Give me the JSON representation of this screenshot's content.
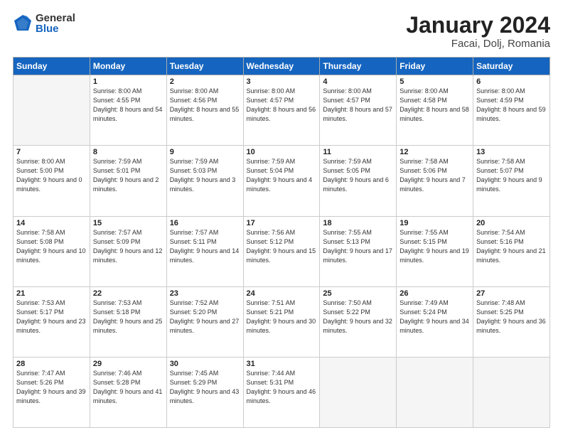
{
  "logo": {
    "general": "General",
    "blue": "Blue"
  },
  "header": {
    "title": "January 2024",
    "subtitle": "Facai, Dolj, Romania"
  },
  "weekdays": [
    "Sunday",
    "Monday",
    "Tuesday",
    "Wednesday",
    "Thursday",
    "Friday",
    "Saturday"
  ],
  "weeks": [
    [
      {
        "day": "",
        "sunrise": "",
        "sunset": "",
        "daylight": ""
      },
      {
        "day": "1",
        "sunrise": "Sunrise: 8:00 AM",
        "sunset": "Sunset: 4:55 PM",
        "daylight": "Daylight: 8 hours and 54 minutes."
      },
      {
        "day": "2",
        "sunrise": "Sunrise: 8:00 AM",
        "sunset": "Sunset: 4:56 PM",
        "daylight": "Daylight: 8 hours and 55 minutes."
      },
      {
        "day": "3",
        "sunrise": "Sunrise: 8:00 AM",
        "sunset": "Sunset: 4:57 PM",
        "daylight": "Daylight: 8 hours and 56 minutes."
      },
      {
        "day": "4",
        "sunrise": "Sunrise: 8:00 AM",
        "sunset": "Sunset: 4:57 PM",
        "daylight": "Daylight: 8 hours and 57 minutes."
      },
      {
        "day": "5",
        "sunrise": "Sunrise: 8:00 AM",
        "sunset": "Sunset: 4:58 PM",
        "daylight": "Daylight: 8 hours and 58 minutes."
      },
      {
        "day": "6",
        "sunrise": "Sunrise: 8:00 AM",
        "sunset": "Sunset: 4:59 PM",
        "daylight": "Daylight: 8 hours and 59 minutes."
      }
    ],
    [
      {
        "day": "7",
        "sunrise": "Sunrise: 8:00 AM",
        "sunset": "Sunset: 5:00 PM",
        "daylight": "Daylight: 9 hours and 0 minutes."
      },
      {
        "day": "8",
        "sunrise": "Sunrise: 7:59 AM",
        "sunset": "Sunset: 5:01 PM",
        "daylight": "Daylight: 9 hours and 2 minutes."
      },
      {
        "day": "9",
        "sunrise": "Sunrise: 7:59 AM",
        "sunset": "Sunset: 5:03 PM",
        "daylight": "Daylight: 9 hours and 3 minutes."
      },
      {
        "day": "10",
        "sunrise": "Sunrise: 7:59 AM",
        "sunset": "Sunset: 5:04 PM",
        "daylight": "Daylight: 9 hours and 4 minutes."
      },
      {
        "day": "11",
        "sunrise": "Sunrise: 7:59 AM",
        "sunset": "Sunset: 5:05 PM",
        "daylight": "Daylight: 9 hours and 6 minutes."
      },
      {
        "day": "12",
        "sunrise": "Sunrise: 7:58 AM",
        "sunset": "Sunset: 5:06 PM",
        "daylight": "Daylight: 9 hours and 7 minutes."
      },
      {
        "day": "13",
        "sunrise": "Sunrise: 7:58 AM",
        "sunset": "Sunset: 5:07 PM",
        "daylight": "Daylight: 9 hours and 9 minutes."
      }
    ],
    [
      {
        "day": "14",
        "sunrise": "Sunrise: 7:58 AM",
        "sunset": "Sunset: 5:08 PM",
        "daylight": "Daylight: 9 hours and 10 minutes."
      },
      {
        "day": "15",
        "sunrise": "Sunrise: 7:57 AM",
        "sunset": "Sunset: 5:09 PM",
        "daylight": "Daylight: 9 hours and 12 minutes."
      },
      {
        "day": "16",
        "sunrise": "Sunrise: 7:57 AM",
        "sunset": "Sunset: 5:11 PM",
        "daylight": "Daylight: 9 hours and 14 minutes."
      },
      {
        "day": "17",
        "sunrise": "Sunrise: 7:56 AM",
        "sunset": "Sunset: 5:12 PM",
        "daylight": "Daylight: 9 hours and 15 minutes."
      },
      {
        "day": "18",
        "sunrise": "Sunrise: 7:55 AM",
        "sunset": "Sunset: 5:13 PM",
        "daylight": "Daylight: 9 hours and 17 minutes."
      },
      {
        "day": "19",
        "sunrise": "Sunrise: 7:55 AM",
        "sunset": "Sunset: 5:15 PM",
        "daylight": "Daylight: 9 hours and 19 minutes."
      },
      {
        "day": "20",
        "sunrise": "Sunrise: 7:54 AM",
        "sunset": "Sunset: 5:16 PM",
        "daylight": "Daylight: 9 hours and 21 minutes."
      }
    ],
    [
      {
        "day": "21",
        "sunrise": "Sunrise: 7:53 AM",
        "sunset": "Sunset: 5:17 PM",
        "daylight": "Daylight: 9 hours and 23 minutes."
      },
      {
        "day": "22",
        "sunrise": "Sunrise: 7:53 AM",
        "sunset": "Sunset: 5:18 PM",
        "daylight": "Daylight: 9 hours and 25 minutes."
      },
      {
        "day": "23",
        "sunrise": "Sunrise: 7:52 AM",
        "sunset": "Sunset: 5:20 PM",
        "daylight": "Daylight: 9 hours and 27 minutes."
      },
      {
        "day": "24",
        "sunrise": "Sunrise: 7:51 AM",
        "sunset": "Sunset: 5:21 PM",
        "daylight": "Daylight: 9 hours and 30 minutes."
      },
      {
        "day": "25",
        "sunrise": "Sunrise: 7:50 AM",
        "sunset": "Sunset: 5:22 PM",
        "daylight": "Daylight: 9 hours and 32 minutes."
      },
      {
        "day": "26",
        "sunrise": "Sunrise: 7:49 AM",
        "sunset": "Sunset: 5:24 PM",
        "daylight": "Daylight: 9 hours and 34 minutes."
      },
      {
        "day": "27",
        "sunrise": "Sunrise: 7:48 AM",
        "sunset": "Sunset: 5:25 PM",
        "daylight": "Daylight: 9 hours and 36 minutes."
      }
    ],
    [
      {
        "day": "28",
        "sunrise": "Sunrise: 7:47 AM",
        "sunset": "Sunset: 5:26 PM",
        "daylight": "Daylight: 9 hours and 39 minutes."
      },
      {
        "day": "29",
        "sunrise": "Sunrise: 7:46 AM",
        "sunset": "Sunset: 5:28 PM",
        "daylight": "Daylight: 9 hours and 41 minutes."
      },
      {
        "day": "30",
        "sunrise": "Sunrise: 7:45 AM",
        "sunset": "Sunset: 5:29 PM",
        "daylight": "Daylight: 9 hours and 43 minutes."
      },
      {
        "day": "31",
        "sunrise": "Sunrise: 7:44 AM",
        "sunset": "Sunset: 5:31 PM",
        "daylight": "Daylight: 9 hours and 46 minutes."
      },
      {
        "day": "",
        "sunrise": "",
        "sunset": "",
        "daylight": ""
      },
      {
        "day": "",
        "sunrise": "",
        "sunset": "",
        "daylight": ""
      },
      {
        "day": "",
        "sunrise": "",
        "sunset": "",
        "daylight": ""
      }
    ]
  ]
}
